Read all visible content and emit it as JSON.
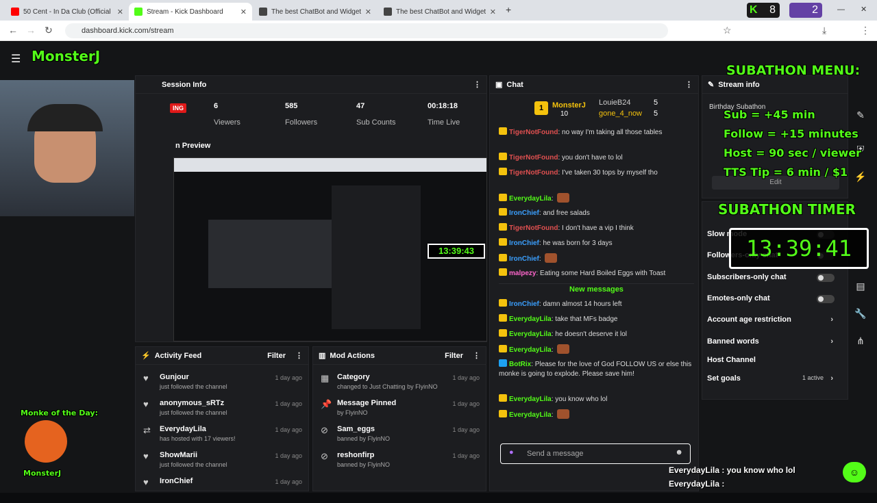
{
  "browser": {
    "tabs": [
      {
        "title": "50 Cent - In Da Club (Official M",
        "color": "#ff0000"
      },
      {
        "title": "Stream - Kick Dashboard",
        "color": "#53fc18"
      },
      {
        "title": "The best ChatBot and Widgets",
        "color": "#444444"
      },
      {
        "title": "The best ChatBot and Widgets",
        "color": "#444444"
      }
    ],
    "url": "dashboard.kick.com/stream",
    "ext_counts": [
      "8",
      "2"
    ]
  },
  "logo": "MonsterJ",
  "session": {
    "title": "Session Info",
    "live_badge": "ING",
    "stats": [
      {
        "value": "6",
        "label": "Viewers"
      },
      {
        "value": "585",
        "label": "Followers"
      },
      {
        "value": "47",
        "label": "Sub Counts"
      },
      {
        "value": "00:18:18",
        "label": "Time Live"
      }
    ],
    "preview_title": "n Preview",
    "preview_timer": "13:39:43"
  },
  "chat": {
    "title": "Chat",
    "top_gifters": [
      {
        "rank": "1",
        "name": "MonsterJ",
        "count": "10"
      },
      {
        "name": "LouieB24",
        "count": "5"
      },
      {
        "name": "gone_4_now",
        "count": "5"
      }
    ],
    "messages": [
      {
        "user": "TigerNotFound",
        "color": "#e05050",
        "text": "no way I'm taking all those tables"
      },
      {
        "user": "TigerNotFound",
        "color": "#e05050",
        "text": "you don't have to lol"
      },
      {
        "user": "TigerNotFound",
        "color": "#e05050",
        "text": "I've taken 30 tops by myself tho"
      },
      {
        "user": "EverydayLila",
        "color": "#53fc18",
        "text": ""
      },
      {
        "user": "IronChief",
        "color": "#3ba0ff",
        "text": "and free salads"
      },
      {
        "user": "TigerNotFound",
        "color": "#e05050",
        "text": "I don't have a vip I think"
      },
      {
        "user": "IronChief",
        "color": "#3ba0ff",
        "text": "he was born for 3 days"
      },
      {
        "user": "IronChief",
        "color": "#3ba0ff",
        "text": ""
      },
      {
        "user": "malpezy",
        "color": "#ff66cc",
        "text": "Eating some Hard Boiled Eggs with Toast"
      }
    ],
    "new_messages_label": "New messages",
    "new_messages": [
      {
        "user": "IronChief",
        "color": "#3ba0ff",
        "text": "damn almost 14 hours left"
      },
      {
        "user": "EverydayLila",
        "color": "#53fc18",
        "text": "take that MFs badge"
      },
      {
        "user": "EverydayLila",
        "color": "#53fc18",
        "text": "he doesn't deserve it lol"
      },
      {
        "user": "EverydayLila",
        "color": "#53fc18",
        "text": ""
      },
      {
        "user": "BotRix",
        "color": "#53fc18",
        "text": "Please for the love of God FOLLOW US or else this monke is going to explode. Please save him!"
      },
      {
        "user": "EverydayLila",
        "color": "#53fc18",
        "text": "you know who lol"
      },
      {
        "user": "EverydayLila",
        "color": "#53fc18",
        "text": ""
      }
    ],
    "input_placeholder": "Send a message"
  },
  "stream_info": {
    "title": "Stream info",
    "subtitle": "Birthday Subathon",
    "edit": "Edit"
  },
  "settings": {
    "rows": [
      {
        "label": "Slow mode",
        "type": "toggle"
      },
      {
        "label": "Followers-only chat",
        "type": "toggle"
      },
      {
        "label": "Subscribers-only chat",
        "type": "toggle"
      },
      {
        "label": "Emotes-only chat",
        "type": "toggle"
      },
      {
        "label": "Account age restriction",
        "type": "chevron"
      },
      {
        "label": "Banned words",
        "type": "chevron"
      },
      {
        "label": "Host Channel",
        "type": "none"
      },
      {
        "label": "Set goals",
        "type": "chevron",
        "extra": "1 active"
      }
    ]
  },
  "activity": {
    "title": "Activity Feed",
    "filter": "Filter",
    "rows": [
      {
        "name": "Gunjour",
        "sub": "just followed the channel",
        "ago": "1 day ago",
        "icon": "heart-icon"
      },
      {
        "name": "anonymous_sRTz",
        "sub": "just followed the channel",
        "ago": "1 day ago",
        "icon": "heart-icon"
      },
      {
        "name": "EverydayLila",
        "sub": "has hosted with 17 viewers!",
        "ago": "1 day ago",
        "icon": "host-icon"
      },
      {
        "name": "ShowMarii",
        "sub": "just followed the channel",
        "ago": "1 day ago",
        "icon": "heart-icon"
      },
      {
        "name": "IronChief",
        "sub": "",
        "ago": "1 day ago",
        "icon": "heart-icon"
      }
    ]
  },
  "mod": {
    "title": "Mod Actions",
    "filter": "Filter",
    "rows": [
      {
        "name": "Category",
        "sub": "changed to Just Chatting by FlyinNO",
        "ago": "1 day ago"
      },
      {
        "name": "Message Pinned",
        "sub": "by FlyinNO",
        "ago": "1 day ago"
      },
      {
        "name": "Sam_eggs",
        "sub": "banned by FlyinNO",
        "ago": "1 day ago"
      },
      {
        "name": "reshonfirp",
        "sub": "banned by FlyinNO",
        "ago": "1 day ago"
      }
    ]
  },
  "overlay": {
    "menu_title": "SUBATHON MENU:",
    "lines": [
      "Sub = +45 min",
      "Follow = +15 minutes",
      "Host = 90 sec / viewer",
      "TTS Tip = 6 min / $1"
    ],
    "timer_title": "SUBATHON TIMER",
    "timer": "13:39:41",
    "monke": "Monke of the Day:",
    "monke_name": "MonsterJ",
    "chat_echo": [
      "EverydayLila : you know who lol",
      "EverydayLila :"
    ]
  }
}
